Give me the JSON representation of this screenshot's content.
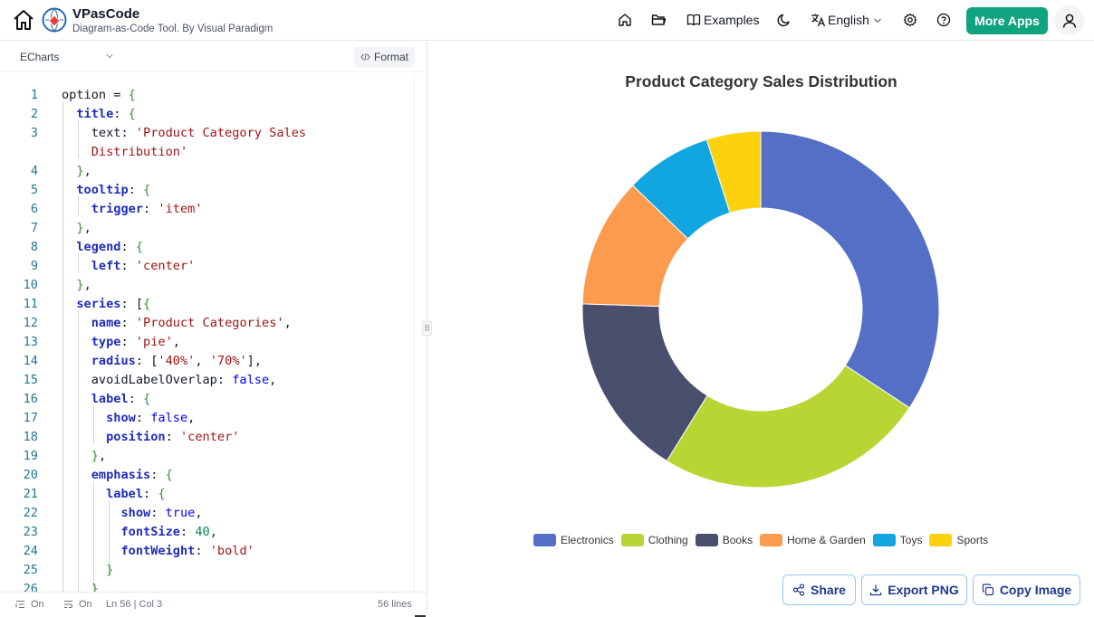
{
  "app": {
    "name": "VPasCode",
    "tagline": "Diagram-as-Code Tool. By Visual Paradigm"
  },
  "nav": {
    "examples_label": "Examples",
    "language_label": "English",
    "more_apps_label": "More Apps"
  },
  "colors": {
    "accent": "#10a37f",
    "button_border": "#93c5fd"
  },
  "editor": {
    "language_select": "ECharts",
    "format_label": "Format",
    "lines": [
      {
        "n": "1",
        "h": "<span class='p'>option = {</span>"
      },
      {
        "n": "2",
        "h": "  <span class='k'>title</span>: {"
      },
      {
        "n": "3",
        "h": "    text: <span class='s'>'Product Category Sales</span>"
      },
      {
        "n": "",
        "h": "    <span class='s'>Distribution'</span>"
      },
      {
        "n": "4",
        "h": "  },"
      },
      {
        "n": "5",
        "h": "  <span class='k'>tooltip</span>: {"
      },
      {
        "n": "6",
        "h": "    <span class='k'>trigger</span>: <span class='s'>'item'</span>"
      },
      {
        "n": "7",
        "h": "  },"
      },
      {
        "n": "8",
        "h": "  <span class='k'>legend</span>: {"
      },
      {
        "n": "9",
        "h": "    <span class='k'>left</span>: <span class='s'>'center'</span>"
      },
      {
        "n": "10",
        "h": "  },"
      },
      {
        "n": "11",
        "h": "  <span class='k'>series</span>: [{"
      },
      {
        "n": "12",
        "h": "    <span class='k'>name</span>: <span class='s'>'Product Categories'</span>,"
      },
      {
        "n": "13",
        "h": "    <span class='k'>type</span>: <span class='s'>'pie'</span>,"
      },
      {
        "n": "14",
        "h": "    <span class='k'>radius</span>: [<span class='s'>'40%'</span>, <span class='s'>'70%'</span>],"
      },
      {
        "n": "15",
        "h": "    avoidLabelOverlap: <span class='b'>false</span>,"
      },
      {
        "n": "16",
        "h": "    <span class='k'>label</span>: {"
      },
      {
        "n": "17",
        "h": "      <span class='k'>show</span>: <span class='b'>false</span>,"
      },
      {
        "n": "18",
        "h": "      <span class='k'>position</span>: <span class='s'>'center'</span>"
      },
      {
        "n": "19",
        "h": "    },"
      },
      {
        "n": "20",
        "h": "    <span class='k'>emphasis</span>: {"
      },
      {
        "n": "21",
        "h": "      <span class='k'>label</span>: {"
      },
      {
        "n": "22",
        "h": "        <span class='k'>show</span>: <span class='b'>true</span>,"
      },
      {
        "n": "23",
        "h": "        <span class='k'>fontSize</span>: <span class='n'>40</span>,"
      },
      {
        "n": "24",
        "h": "        <span class='k'>fontWeight</span>: <span class='s'>'bold'</span>"
      },
      {
        "n": "25",
        "h": "      }"
      },
      {
        "n": "26",
        "h": "    }"
      }
    ]
  },
  "status": {
    "wrap_state": "On",
    "minimap_state": "On",
    "cursor": "Ln 56 | Col 3",
    "line_count": "56 lines"
  },
  "actions": {
    "share_label": "Share",
    "export_label": "Export PNG",
    "copy_label": "Copy Image"
  },
  "chart_data": {
    "type": "pie",
    "title": "Product Category Sales Distribution",
    "inner_radius": "40%",
    "outer_radius": "70%",
    "legend_position": "bottom-center",
    "categories": [
      "Electronics",
      "Clothing",
      "Books",
      "Home & Garden",
      "Toys",
      "Sports"
    ],
    "values": [
      35,
      25,
      17,
      12,
      8,
      5
    ],
    "colors": [
      "#5470c6",
      "#b8d633",
      "#4b4f6e",
      "#fc9a4e",
      "#11a6df",
      "#fdd10d"
    ]
  }
}
